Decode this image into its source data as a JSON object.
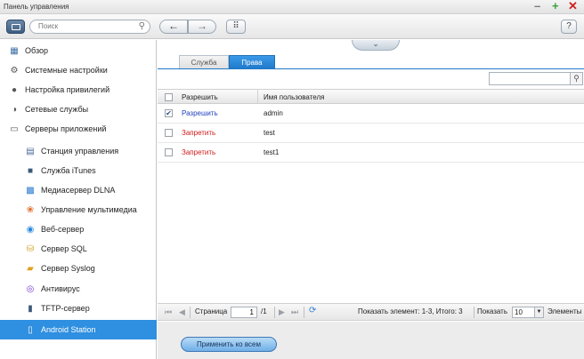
{
  "window": {
    "title": "Панель управления"
  },
  "toolbar": {
    "search_placeholder": "Поиск"
  },
  "sidebar": {
    "items": [
      {
        "label": "Обзор",
        "icon": "overview-icon",
        "glyph": "▦",
        "color": "#3a6ea5"
      },
      {
        "label": "Системные настройки",
        "icon": "gear-icon",
        "glyph": "⚙",
        "color": "#555555"
      },
      {
        "label": "Настройка привилегий",
        "icon": "user-icon",
        "glyph": "👤",
        "color": "#555555"
      },
      {
        "label": "Сетевые службы",
        "icon": "network-icon",
        "glyph": "◑",
        "color": "#555555"
      },
      {
        "label": "Серверы приложений",
        "icon": "server-icon",
        "glyph": "▭",
        "color": "#555555"
      }
    ],
    "subitems": [
      {
        "label": "Станция управления",
        "icon": "surveillance-icon",
        "glyph": "▤",
        "color": "#4a6a9a"
      },
      {
        "label": "Служба iTunes",
        "icon": "itunes-icon",
        "glyph": "■",
        "color": "#3a5a7a"
      },
      {
        "label": "Медиасервер DLNA",
        "icon": "dlna-icon",
        "glyph": "▩",
        "color": "#2a7ad0"
      },
      {
        "label": "Управление мультимедиа",
        "icon": "multimedia-icon",
        "glyph": "❀",
        "color": "#e07030"
      },
      {
        "label": "Веб-сервер",
        "icon": "web-server-icon",
        "glyph": "◉",
        "color": "#2a8ae0"
      },
      {
        "label": "Сервер SQL",
        "icon": "sql-icon",
        "glyph": "⛁",
        "color": "#d4a020"
      },
      {
        "label": "Сервер Syslog",
        "icon": "syslog-icon",
        "glyph": "▰",
        "color": "#e0a020"
      },
      {
        "label": "Антивирус",
        "icon": "antivirus-icon",
        "glyph": "◎",
        "color": "#7a3ad0"
      },
      {
        "label": "TFTP-сервер",
        "icon": "tftp-icon",
        "glyph": "▮",
        "color": "#3a5a7a"
      },
      {
        "label": "Android Station",
        "icon": "android-icon",
        "glyph": "▯",
        "color": "#ffffff"
      }
    ]
  },
  "main": {
    "tabs": [
      {
        "label": "Служба"
      },
      {
        "label": "Права"
      }
    ],
    "grid": {
      "headers": {
        "permission": "Разрешить",
        "username": "Имя пользователя"
      },
      "rows": [
        {
          "permission": "Разрешить",
          "username": "admin",
          "checked": true
        },
        {
          "permission": "Запретить",
          "username": "test",
          "checked": false
        },
        {
          "permission": "Запретить",
          "username": "test1",
          "checked": false
        }
      ]
    },
    "pager": {
      "page_label": "Страница",
      "page_value": "1",
      "total_pages": "/1",
      "summary": "Показать элемент: 1-3, Итого: 3",
      "show_label": "Показать",
      "page_size": "10",
      "items_label": "Элементы"
    },
    "apply_all_label": "Применить ко всем"
  }
}
